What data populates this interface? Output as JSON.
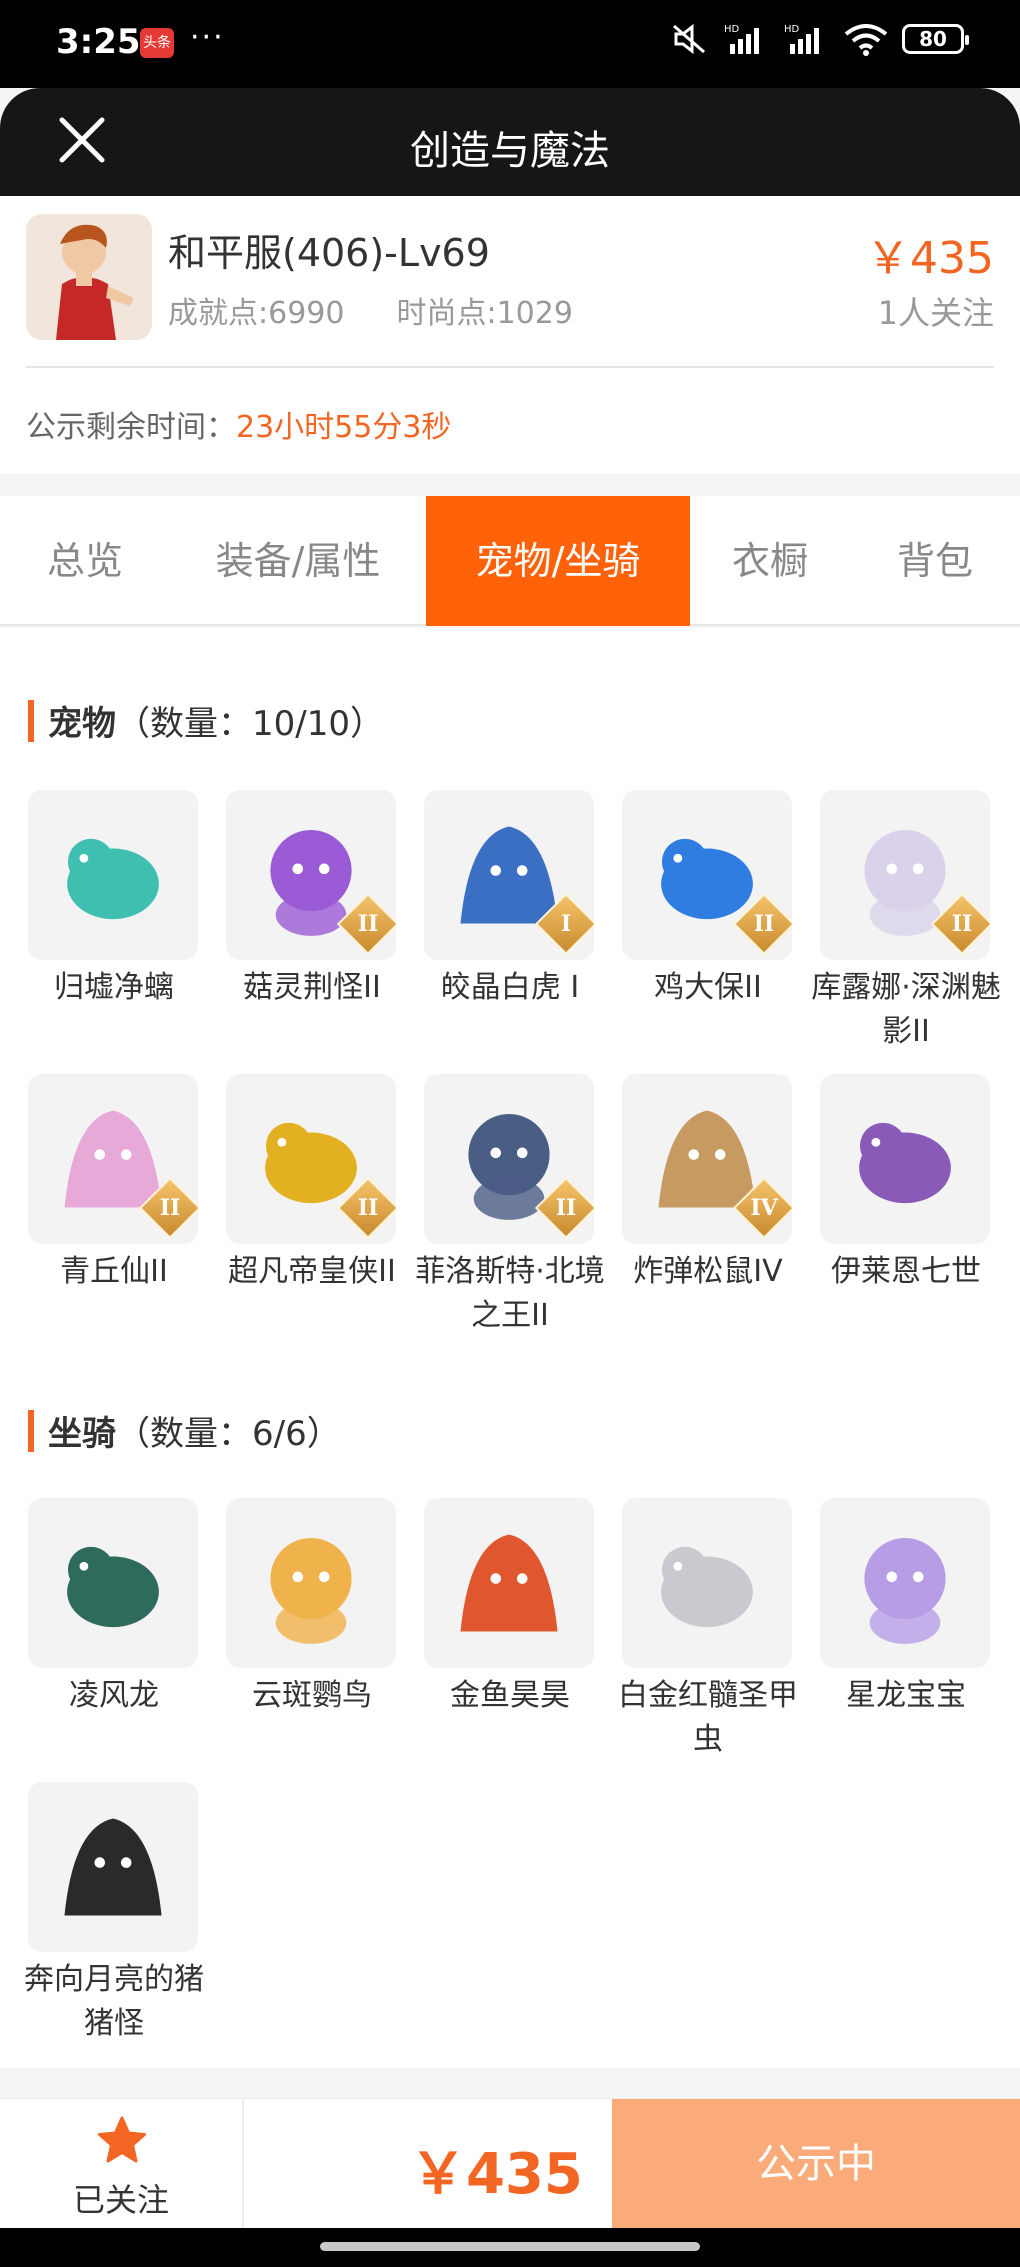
{
  "status_bar": {
    "time": "3:25",
    "app_badge": "头条",
    "dots": "···",
    "battery": "80",
    "icons": [
      "mute-icon",
      "hd-signal-icon",
      "hd-signal-icon",
      "wifi-icon",
      "battery-icon"
    ]
  },
  "header": {
    "title": "创造与魔法",
    "close_icon": "close-icon"
  },
  "listing": {
    "server_level": "和平服(406)-Lv69",
    "price": "￥435",
    "achievement": "成就点:6990",
    "fashion": "时尚点:1029",
    "followers": "1人关注",
    "countdown_label": "公示剩余时间：",
    "countdown_value": "23小时55分3秒"
  },
  "tabs": [
    {
      "label": "总览",
      "active": false
    },
    {
      "label": "装备/属性",
      "active": false
    },
    {
      "label": "宠物/坐骑",
      "active": true
    },
    {
      "label": "衣橱",
      "active": false
    },
    {
      "label": "背包",
      "active": false
    }
  ],
  "pets": {
    "title": "宠物",
    "count": "（数量：10/10）",
    "items": [
      {
        "name": "归墟净螭",
        "grade": "",
        "color": "#3fbfb0"
      },
      {
        "name": "菇灵荆怪II",
        "grade": "II",
        "color": "#9b5bd6"
      },
      {
        "name": "皎晶白虎 I",
        "grade": "I",
        "color": "#3a6fc4"
      },
      {
        "name": "鸡大保II",
        "grade": "II",
        "color": "#2f7de0"
      },
      {
        "name": "库露娜·深渊魅影II",
        "grade": "II",
        "color": "#d9d2ea"
      },
      {
        "name": "青丘仙II",
        "grade": "II",
        "color": "#e7a9d8"
      },
      {
        "name": "超凡帝皇侠II",
        "grade": "II",
        "color": "#e3b021"
      },
      {
        "name": "菲洛斯特·北境之王II",
        "grade": "II",
        "color": "#4a5d85"
      },
      {
        "name": "炸弹松鼠IV",
        "grade": "IV",
        "color": "#c79a62"
      },
      {
        "name": "伊莱恩七世",
        "grade": "",
        "color": "#8a5ab8"
      }
    ]
  },
  "mounts": {
    "title": "坐骑",
    "count": "（数量：6/6）",
    "items": [
      {
        "name": "凌风龙",
        "color": "#2f6b5c"
      },
      {
        "name": "云斑鹦鸟",
        "color": "#f0b24a"
      },
      {
        "name": "金鱼昊昊",
        "color": "#e0572f"
      },
      {
        "name": "白金红髓圣甲虫",
        "color": "#c9c9cf"
      },
      {
        "name": "星龙宝宝",
        "color": "#b79de6"
      },
      {
        "name": "奔向月亮的猪猪怪",
        "color": "#2a2a2a"
      }
    ]
  },
  "bottom_bar": {
    "follow_label": "已关注",
    "price": "￥435",
    "status_button": "公示中"
  },
  "colors": {
    "accent": "#ff6208",
    "price": "#f26522",
    "status_button": "#fbaa7a"
  }
}
